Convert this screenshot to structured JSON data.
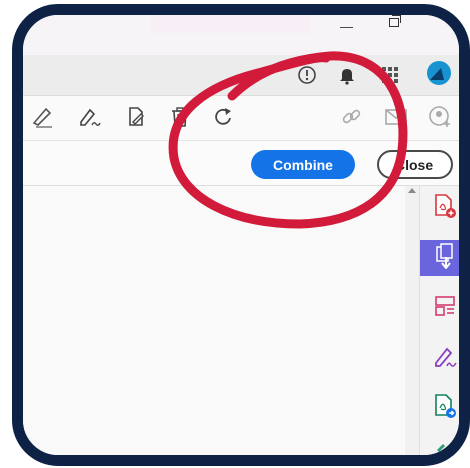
{
  "titlebar": {
    "minimize_glyph": "—"
  },
  "header": {
    "icons": [
      "help-icon",
      "bell-icon",
      "apps-grid-icon",
      "avatar"
    ]
  },
  "toolbar": {
    "tools": [
      "highlight-icon",
      "fill-sign-icon",
      "edit-pdf-icon",
      "delete-icon",
      "rotate-icon",
      "link-icon",
      "mail-icon",
      "share-user-icon"
    ]
  },
  "actions": {
    "combine_label": "Combine",
    "close_label": "Close"
  },
  "right_panel": {
    "items": [
      "export-pdf-icon",
      "create-pdf-icon",
      "organize-pages-icon",
      "fill-sign-icon",
      "export-icon",
      "compress-icon"
    ],
    "active_index": 1
  },
  "colors": {
    "frame": "#0d2245",
    "accent": "#1473e6",
    "annotation": "#d21a3a",
    "active_tool": "#6a64dd"
  }
}
